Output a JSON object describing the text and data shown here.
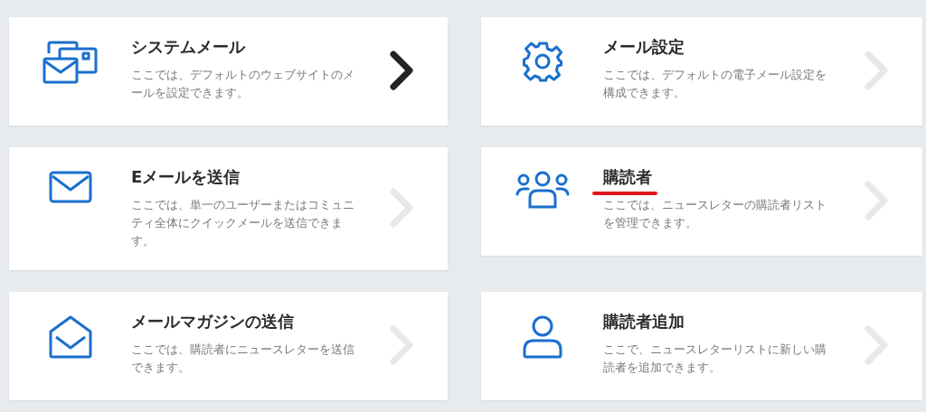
{
  "cards": [
    {
      "title": "システムメール",
      "description": "ここでは、デフォルトのウェブサイトのメールを設定できます。",
      "highlighted": true,
      "marked": false
    },
    {
      "title": "メール設定",
      "description": "ここでは、デフォルトの電子メール設定を構成できます。",
      "highlighted": false,
      "marked": false
    },
    {
      "title": "Eメールを送信",
      "description": "ここでは、単一のユーザーまたはコミュニティ全体にクイックメールを送信できます。",
      "highlighted": false,
      "marked": false
    },
    {
      "title": "購読者",
      "description": "ここでは、ニュースレターの購読者リストを管理できます。",
      "highlighted": false,
      "marked": true
    },
    {
      "title": "メールマガジンの送信",
      "description": "ここでは、購読者にニュースレターを送信できます。",
      "highlighted": false,
      "marked": false
    },
    {
      "title": "購読者追加",
      "description": "ここで、ニュースレターリストに新しい購読者を追加できます。",
      "highlighted": false,
      "marked": false
    }
  ]
}
